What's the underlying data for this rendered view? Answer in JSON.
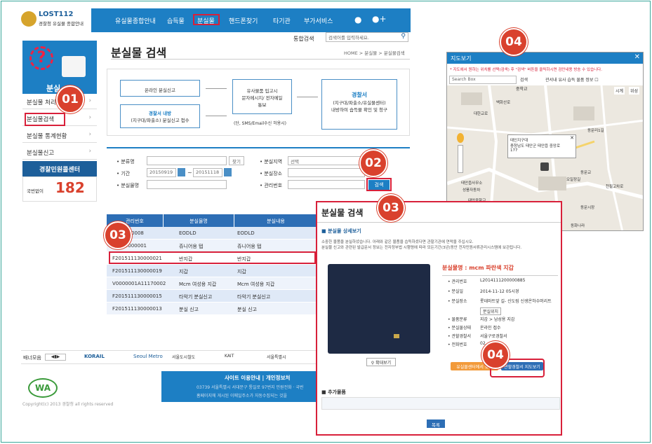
{
  "site": {
    "logo_title": "LOST112",
    "logo_sub": "경찰청 유실물 종합안내",
    "nav": [
      "유실물종합안내",
      "습득물",
      "분실물",
      "핸드폰찾기",
      "타기관",
      "부가서비스"
    ],
    "search_label": "통합검색",
    "search_placeholder": "검색어를 입력하세요.",
    "page_title": "분실물 검색",
    "breadcrumb": "HOME > 분실물 > 분실물검색"
  },
  "sidebar": {
    "title": "분실",
    "items": [
      "분실물 처리",
      "분실물검색",
      "분실물 통계현황",
      "분실물신고"
    ],
    "callcenter": "경찰민원콜센터",
    "call_label": "국번없이",
    "call_number": "182"
  },
  "flow": {
    "box1": "온라인 분실신고",
    "box2_title": "경찰서 내방",
    "box2_sub": "(지구대/파출소) 분실신고 접수",
    "box3_l1": "유사물품 입고시",
    "box3_l2": "문자메시지/ 전자메일",
    "box3_l3": "통보",
    "box3_note": "(단, SMS/Email수신 허용시)",
    "box4_title": "경찰서",
    "box4_l1": "(지구대/파출소/유실물센터)",
    "box4_l2": "내방하여 습득물 확인 및 청구"
  },
  "form": {
    "category_label": "분류명",
    "period_label": "기간",
    "item_label": "분실물명",
    "region_label": "분실지역",
    "place_label": "분실장소",
    "mgmt_label": "관리번호",
    "find_btn": "찾기",
    "date_from": "20150919",
    "date_to": "20151118",
    "region_value": "선택",
    "search_btn": "검색"
  },
  "table": {
    "headers": [
      "관리번호",
      "분실물명",
      "분실내용"
    ],
    "rows": [
      [
        "6A11170008",
        "EODLD",
        "EODLD"
      ],
      [
        "11170000001",
        "쥬니어용 탭",
        "쥬니어용 탭"
      ],
      [
        "F201511130000021",
        "반지갑",
        "반지갑"
      ],
      [
        "F201511130000019",
        "지갑",
        "지갑"
      ],
      [
        "V0000001A11170002",
        "Mcm 여성용 지갑",
        "Mcm 여성용 지갑"
      ],
      [
        "F201511130000015",
        "타악기 분실신고",
        "타악기 분실신고"
      ],
      [
        "F201511130000013",
        "분실 신고",
        "분실 신고"
      ]
    ]
  },
  "banner": {
    "label": "배너모음",
    "logos": [
      "KORAIL",
      "Seoul Metro",
      "서울도시철도",
      "KAIT",
      "서울특별시"
    ]
  },
  "footer": {
    "links": "사이트 이용안내 | 개인정보처",
    "address": "03739 서울특별시 서대문구 통일로 97번지 민원전화 · 국번",
    "notice": "홈페이지에 게시된 이메일주소가 자동수집되는 것을",
    "copyright": "Copyright(c) 2013 경찰청 all rights reserved",
    "wa": "WA"
  },
  "detail": {
    "title": "분실물 검색",
    "section": "분실물 상세보기",
    "intro": "소중한 물품을 분실하셨습니다. 아래와 같은 물품을 습득하셨다면 관할기관에 연락을 주십시오.",
    "intro2": "분실물 신고와 관련된 발급문서 정보는 전자정부법 시행령에 따라 모든기간(3년)동안 전자민원서류관리시스템에 보관됩니다.",
    "item_name": "분실물명 : mcm 파란색 지갑",
    "zoom_btn": "확대보기",
    "fields": [
      [
        "관리번호",
        "L2014111200000885"
      ],
      [
        "분실일",
        "2014-11-12 05시경"
      ],
      [
        "분실장소",
        "롯데마트앞 길- 신도림 신생온하수머리트"
      ],
      [
        "물품분류",
        "지갑 > 남성용 지갑"
      ],
      [
        "분실물상태",
        "온라인 접수"
      ],
      [
        "관할경찰서",
        "서울구로경찰서"
      ],
      [
        "전화번호",
        "02"
      ]
    ],
    "place_btn": "분실위치",
    "center_btn": "유실물센터에서 찾기",
    "map_btn": "관할경찰서 지도보기",
    "extra": "추가물품",
    "list_btn": "목록"
  },
  "map": {
    "title": "지도보기",
    "notice": "* 지도에서 원하는 위치를 선택(검색) 후 \"검색\" 버튼을 클릭하시면 검만내용 방송 수 있습니다.",
    "search_placeholder": "Search Box",
    "search_btn": "검색",
    "checkbox_label": "관서내 유사 습득 물품 정보",
    "info_l1": "태인지구대",
    "info_l2": "충청남도 태안군 태안읍 중앙로",
    "info_l3": "177",
    "labels": [
      "중학교",
      "시계",
      "위성",
      "대한교로",
      "백화산로",
      "동문리1길",
      "태안읍사무소",
      "성풍자동차",
      "태안중학교",
      "동문교",
      "오일장길",
      "천필고차로",
      "동문시장",
      "동화나라"
    ]
  },
  "badges": {
    "b01": "01",
    "b02": "02",
    "b03a": "03",
    "b03b": "03",
    "b04a": "04",
    "b04b": "04"
  },
  "colors": {
    "accent": "#1d7fc4",
    "badge": "#d9412d",
    "highlight": "#d8203a",
    "table_head": "#2d6eb5"
  }
}
